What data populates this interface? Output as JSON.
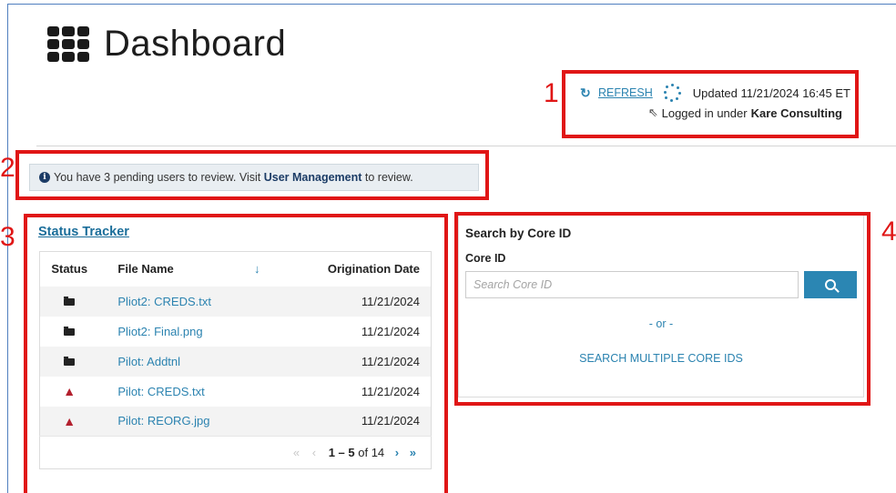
{
  "header": {
    "title": "Dashboard"
  },
  "annotations": [
    "1",
    "2",
    "3",
    "4"
  ],
  "refresh": {
    "link_label": "REFRESH",
    "updated_text": "Updated 11/21/2024 16:45 ET",
    "logged_prefix": "Logged in under",
    "organization": "Kare Consulting"
  },
  "alert": {
    "prefix": "You have 3 pending users to review. Visit",
    "link": "User Management",
    "suffix": "to review."
  },
  "status_tracker": {
    "title": "Status Tracker",
    "columns": {
      "status": "Status",
      "file_name": "File Name",
      "origination_date": "Origination Date"
    },
    "rows": [
      {
        "status_icon": "folder-icon",
        "file_name": "Pliot2: CREDS.txt",
        "date": "11/21/2024"
      },
      {
        "status_icon": "folder-icon",
        "file_name": "Pliot2: Final.png",
        "date": "11/21/2024"
      },
      {
        "status_icon": "folder-icon",
        "file_name": "Pilot: Addtnl",
        "date": "11/21/2024"
      },
      {
        "status_icon": "warning-icon",
        "file_name": "Pilot: CREDS.txt",
        "date": "11/21/2024"
      },
      {
        "status_icon": "warning-icon",
        "file_name": "Pilot: REORG.jpg",
        "date": "11/21/2024"
      }
    ],
    "pagination": {
      "range": "1 – 5",
      "of_total": "of 14"
    }
  },
  "search": {
    "heading": "Search by Core ID",
    "field_label": "Core ID",
    "placeholder": "Search Core ID",
    "or_text": "- or -",
    "multiple_link": "SEARCH MULTIPLE CORE IDS"
  },
  "colors": {
    "accent": "#2b83b0",
    "annotation": "#e01616",
    "warning": "#b3202e"
  }
}
